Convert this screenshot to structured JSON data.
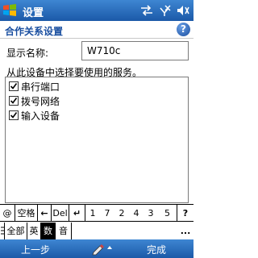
{
  "titlebar": {
    "title": "设置",
    "icons": [
      "windows-flag-icon",
      "connectivity-icon",
      "phone-signal-off-icon",
      "volume-icon"
    ]
  },
  "header": {
    "title": "合作关系设置",
    "help_icon": "help-icon"
  },
  "form": {
    "name_label": "显示名称:",
    "name_value": "W710c"
  },
  "instruction": "从此设备中选择要使用的服务。",
  "services": [
    {
      "label": "串行端口",
      "checked": true
    },
    {
      "label": "拨号网络",
      "checked": true
    },
    {
      "label": "输入设备",
      "checked": true
    }
  ],
  "keyboard": {
    "row1": [
      "@",
      "空格",
      "←",
      "Del",
      "↵",
      "1",
      "7",
      "2",
      "4",
      "3",
      "5",
      "?"
    ],
    "row2": [
      "全部",
      "英",
      "数",
      "音",
      "..."
    ],
    "selected_mode": "数"
  },
  "softkeys": {
    "left": "上一步",
    "right": "完成"
  },
  "colors": {
    "bar": "#1b59a8",
    "header_text": "#1a4fa0"
  }
}
